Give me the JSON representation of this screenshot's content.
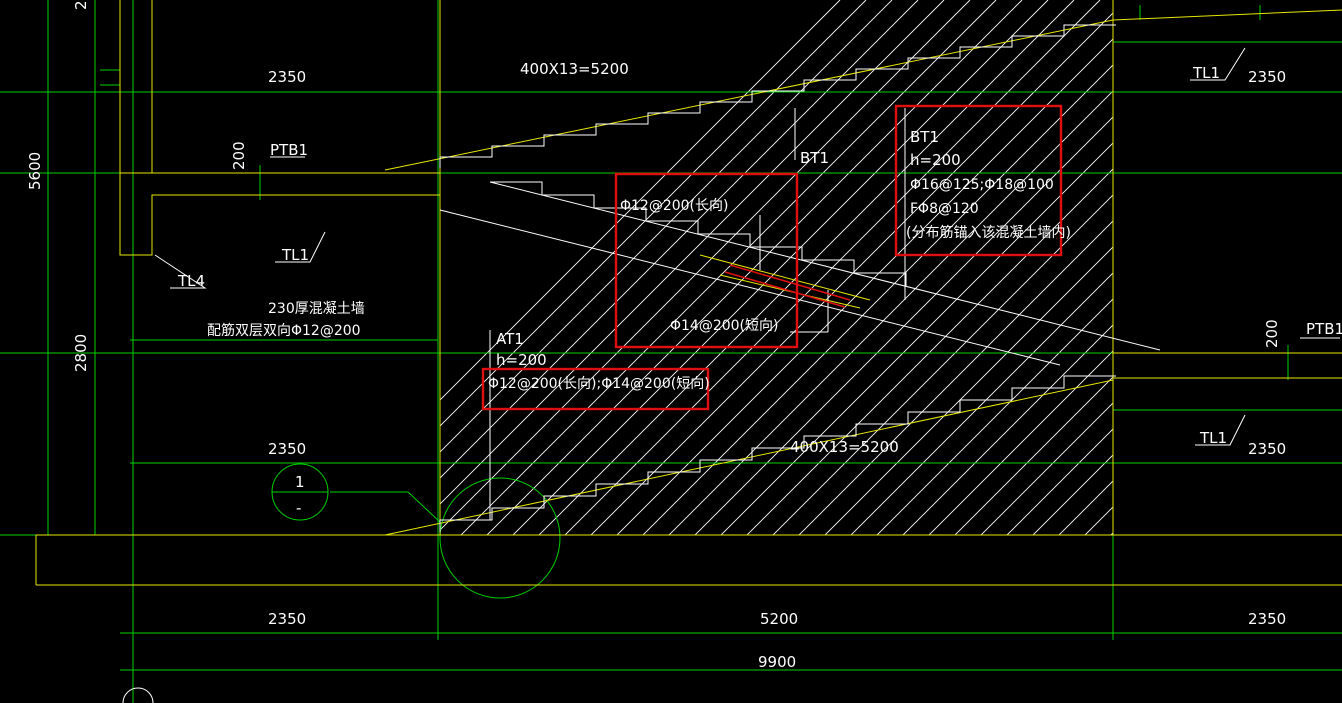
{
  "dims": {
    "top_left": "2350",
    "top_mid": "400X13=5200",
    "top_right": "2350",
    "mid_left": "2350",
    "mid_mid": "400X13=5200",
    "mid_right": "2350",
    "bot_left": "2350",
    "bot_mid": "5200",
    "bot_right": "2350",
    "total": "9900",
    "height_upper": "5600",
    "height_lower": "2800",
    "slab_left": "200",
    "slab_right": "200",
    "top_cut": "2"
  },
  "labels": {
    "ptb1_left": "PTB1",
    "ptb1_right": "PTB1",
    "tl1_left": "TL1",
    "tl1_top_right": "TL1",
    "tl1_bottom_right": "TL1",
    "tl4": "TL4",
    "bt1_tag": "BT1",
    "wall_line1": "230厚混凝土墙",
    "wall_line2": "配筋双层双向Φ12@200"
  },
  "at1": {
    "name": "AT1",
    "h": "h=200",
    "rebar": "Φ12@200(长向);Φ14@200(短向)"
  },
  "bt1_box": {
    "name": "BT1",
    "h": "h=200",
    "rebar": "Φ16@125;Φ18@100",
    "dist": "FΦ8@120",
    "note": "(分布筋锚入该混凝土墙内)"
  },
  "detail": {
    "long": "Φ12@200(长向)",
    "short": "Φ14@200(短向)"
  },
  "section_mark": {
    "num": "1",
    "sub": "-"
  },
  "colors": {
    "bg": "#000000",
    "grid": "#00d000",
    "outline": "#e6e600",
    "text": "#ffffff",
    "highlight": "#e01010"
  }
}
